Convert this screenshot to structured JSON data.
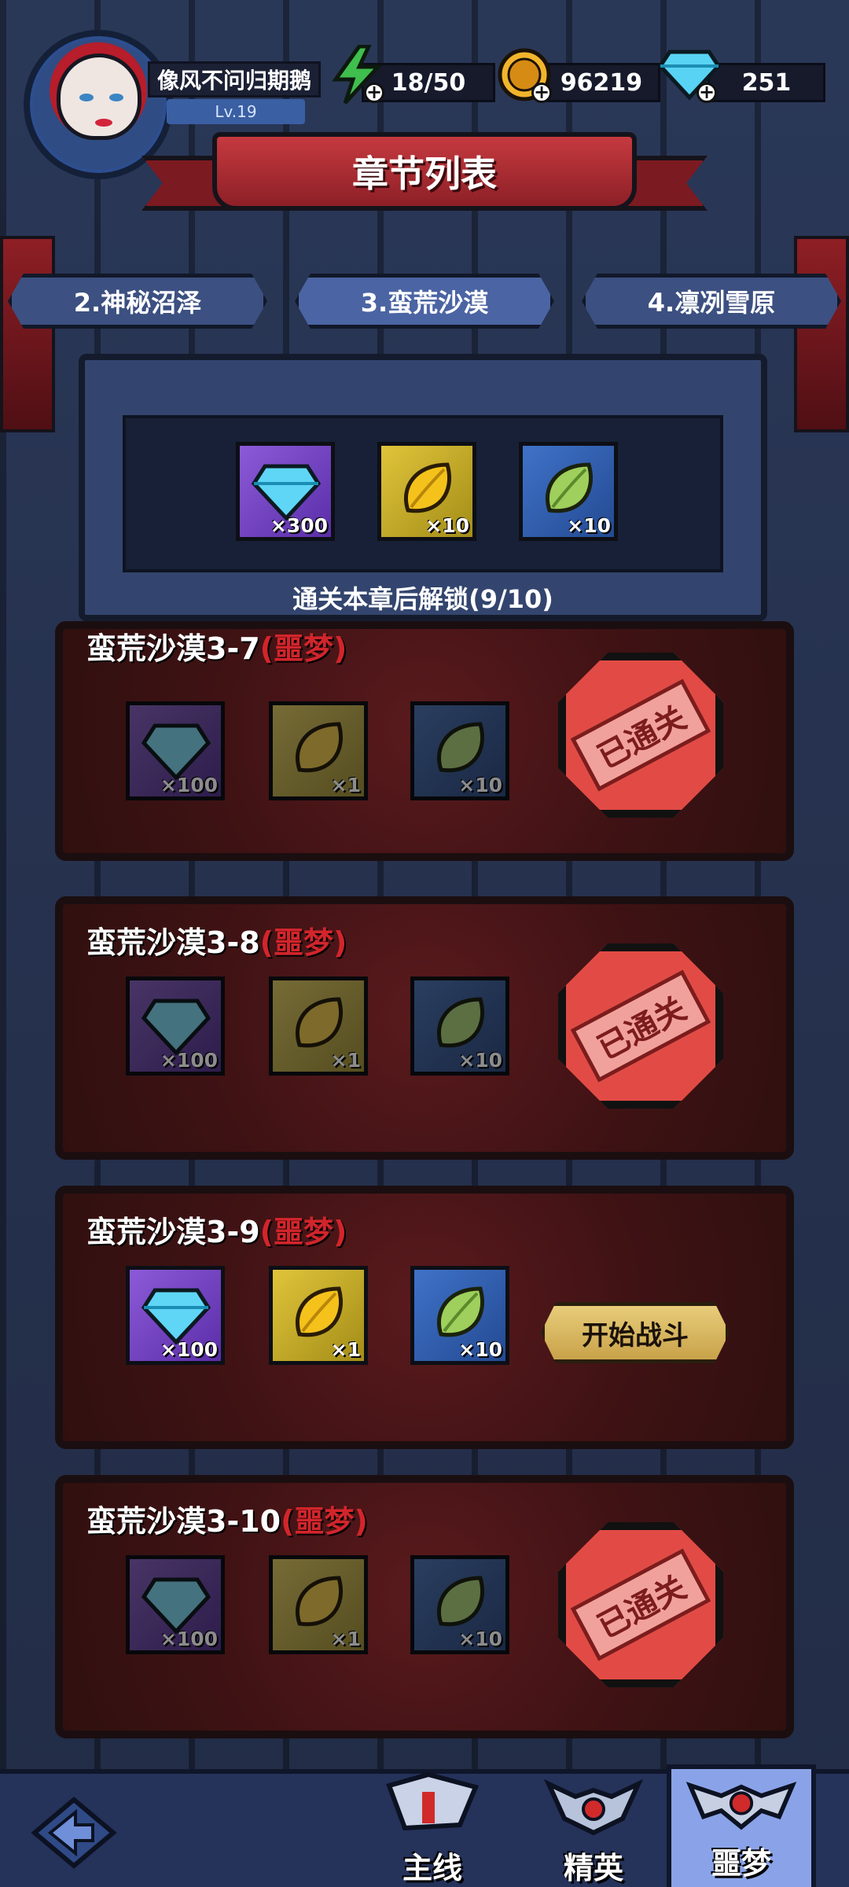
{
  "player": {
    "name": "像风不问归期鹅",
    "level": "Lv.19"
  },
  "resources": {
    "energy": "18/50",
    "gold": "96219",
    "gems": "251"
  },
  "title": "章节列表",
  "chapter_tabs": [
    {
      "label": "2.神秘沼泽"
    },
    {
      "label": "3.蛮荒沙漠"
    },
    {
      "label": "4.凛冽雪原"
    }
  ],
  "chapter_reward": {
    "items": [
      {
        "icon": "gem-icon",
        "count": "×300"
      },
      {
        "icon": "gold-leaf-icon",
        "count": "×10"
      },
      {
        "icon": "green-leaf-icon",
        "count": "×10"
      }
    ],
    "status": "通关本章后解锁(9/10)"
  },
  "stages": [
    {
      "name": "蛮荒沙漠3-7",
      "difficulty": "(噩梦)",
      "rewards": [
        "×100",
        "×1",
        "×10"
      ],
      "cleared": true,
      "stamp": "已通关"
    },
    {
      "name": "蛮荒沙漠3-8",
      "difficulty": "(噩梦)",
      "rewards": [
        "×100",
        "×1",
        "×10"
      ],
      "cleared": true,
      "stamp": "已通关"
    },
    {
      "name": "蛮荒沙漠3-9",
      "difficulty": "(噩梦)",
      "rewards": [
        "×100",
        "×1",
        "×10"
      ],
      "cleared": false,
      "action": "开始战斗"
    },
    {
      "name": "蛮荒沙漠3-10",
      "difficulty": "(噩梦)",
      "rewards": [
        "×100",
        "×1",
        "×10"
      ],
      "cleared": true,
      "stamp": "已通关"
    }
  ],
  "bottom_nav": {
    "tabs": [
      {
        "label": "主线"
      },
      {
        "label": "精英"
      },
      {
        "label": "噩梦"
      }
    ]
  }
}
